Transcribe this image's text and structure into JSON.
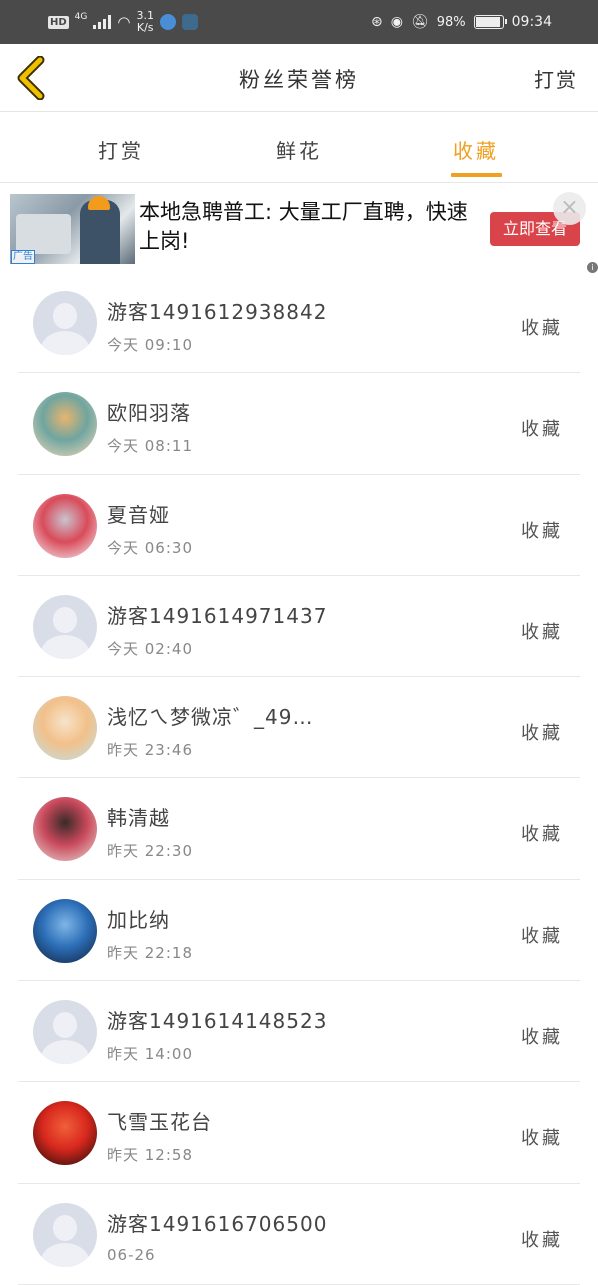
{
  "status_bar": {
    "hd": "HD",
    "network": "4G",
    "speed_value": "3.1",
    "speed_unit": "K/s",
    "battery": "98%",
    "battery_level": 0.98,
    "time": "09:34"
  },
  "nav": {
    "title": "粉丝荣誉榜",
    "right_label": "打赏"
  },
  "tabs": [
    {
      "label": "打赏",
      "active": false
    },
    {
      "label": "鲜花",
      "active": false
    },
    {
      "label": "收藏",
      "active": true
    }
  ],
  "ad": {
    "text": "本地急聘普工: 大量工厂直聘，快速上岗!",
    "cta": "立即查看",
    "tag": "广告",
    "close": "×"
  },
  "fans": [
    {
      "name": "游客1491612938842",
      "time": "今天 09:10",
      "action": "收藏",
      "avatar": "default-avatar"
    },
    {
      "name": "欧阳羽落",
      "time": "今天 08:11",
      "action": "收藏",
      "avatar": "doll-avatar",
      "avatar_colors": [
        "#f3d9b8",
        "#6fa5a0",
        "#e8b56f"
      ]
    },
    {
      "name": "夏音娅",
      "time": "今天 06:30",
      "action": "收藏",
      "avatar": "anime-avatar",
      "avatar_colors": [
        "#f5f2f4",
        "#d94b5a",
        "#c9c3cf"
      ]
    },
    {
      "name": "游客1491614971437",
      "time": "今天 02:40",
      "action": "收藏",
      "avatar": "default-avatar"
    },
    {
      "name": "浅忆ㄟ梦微凉゛_49…",
      "time": "昨天 23:46",
      "action": "收藏",
      "avatar": "anime-girl-avatar",
      "avatar_colors": [
        "#bfe0e8",
        "#f2c08a",
        "#f7e3c9"
      ]
    },
    {
      "name": "韩清越",
      "time": "昨天 22:30",
      "action": "收藏",
      "avatar": "photo-avatar",
      "avatar_colors": [
        "#e9dcd5",
        "#c9495c",
        "#3a2a27"
      ]
    },
    {
      "name": "加比纳",
      "time": "昨天 22:18",
      "action": "收藏",
      "avatar": "mecha-avatar",
      "avatar_colors": [
        "#0d1f3a",
        "#2d6fb8",
        "#7fb6e6"
      ]
    },
    {
      "name": "游客1491614148523",
      "time": "昨天 14:00",
      "action": "收藏",
      "avatar": "default-avatar"
    },
    {
      "name": "飞雪玉花台",
      "time": "昨天 12:58",
      "action": "收藏",
      "avatar": "flower-avatar",
      "avatar_colors": [
        "#1a0a08",
        "#d8281e",
        "#f0603a"
      ]
    },
    {
      "name": "游客1491616706500",
      "time": "06-26",
      "action": "收藏",
      "avatar": "default-avatar"
    }
  ],
  "colors": {
    "accent": "#f0a020",
    "status_bar": "#4a4a4a",
    "ad_button": "#d9434a",
    "back_arrow": "#f0c000"
  }
}
